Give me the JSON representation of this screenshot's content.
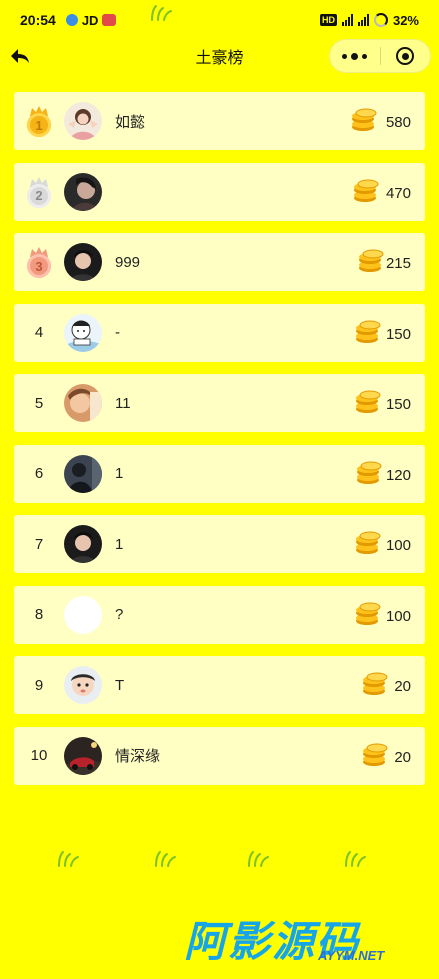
{
  "status_bar": {
    "time": "20:54",
    "carrier": "JD",
    "battery": "32%",
    "network_1": "5G",
    "network_2": "5G"
  },
  "nav": {
    "title": "土豪榜"
  },
  "colors": {
    "background": "#FFFF00",
    "row_background": "#FFFFC4",
    "gold": "#F5B316",
    "silver": "#D9D9D9",
    "bronze": "#F29A7E"
  },
  "rows": [
    {
      "rank": "1",
      "medal": "gold",
      "name": "如懿",
      "score": "580",
      "avatar": "avatar-girl-drawing"
    },
    {
      "rank": "2",
      "medal": "silver",
      "name": "",
      "score": "470",
      "avatar": "avatar-dark-portrait"
    },
    {
      "rank": "3",
      "medal": "bronze",
      "name": "999",
      "score": "215",
      "avatar": "avatar-boy-portrait"
    },
    {
      "rank": "4",
      "medal": "",
      "name": "-",
      "score": "150",
      "avatar": "avatar-cartoon-kid"
    },
    {
      "rank": "5",
      "medal": "",
      "name": "11",
      "score": "150",
      "avatar": "avatar-warm-photo"
    },
    {
      "rank": "6",
      "medal": "",
      "name": "1",
      "score": "120",
      "avatar": "avatar-dark-figure"
    },
    {
      "rank": "7",
      "medal": "",
      "name": "1",
      "score": "100",
      "avatar": "avatar-boy-portrait"
    },
    {
      "rank": "8",
      "medal": "",
      "name": "?",
      "score": "100",
      "avatar": "avatar-blank"
    },
    {
      "rank": "9",
      "medal": "",
      "name": "T",
      "score": "20",
      "avatar": "avatar-baby"
    },
    {
      "rank": "10",
      "medal": "",
      "name": "情深缘",
      "score": "20",
      "avatar": "avatar-car-night"
    }
  ],
  "watermark": {
    "title": "阿影源码",
    "subtitle": "AYYM.NET"
  }
}
